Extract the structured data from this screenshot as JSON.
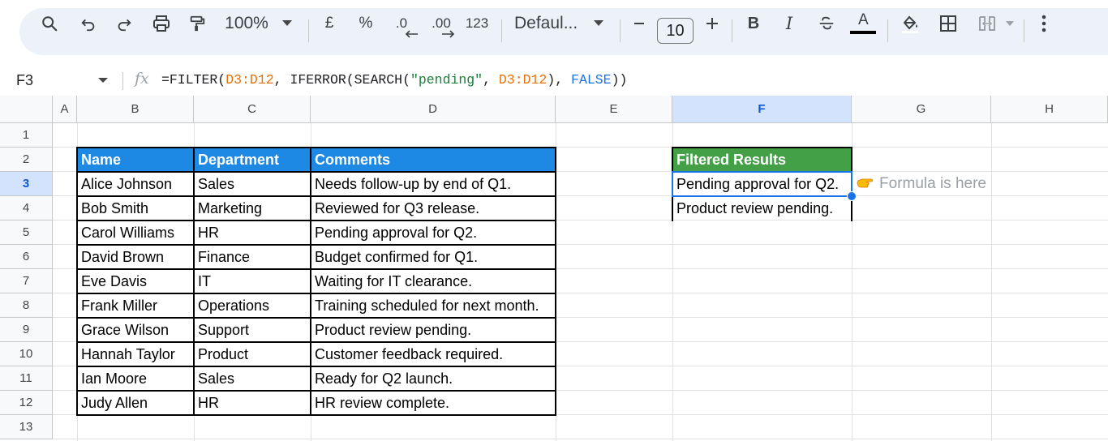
{
  "toolbar": {
    "zoom": "100%",
    "currency": "£",
    "percent": "%",
    "decrease_decimal": ".0",
    "increase_decimal": ".00",
    "number_format": "123",
    "font": "Defaul...",
    "font_size": "10",
    "bold": "B",
    "italic": "I",
    "text_color_letter": "A"
  },
  "formula_bar": {
    "cell_ref": "F3",
    "fx": "fx",
    "formula_parts": [
      "=FILTER(",
      "D3:D12",
      ", IFERROR(SEARCH(",
      "\"pending\"",
      ", ",
      "D3:D12",
      "), ",
      "FALSE",
      "))"
    ]
  },
  "columns": [
    "A",
    "B",
    "C",
    "D",
    "E",
    "F",
    "G",
    "H"
  ],
  "selected_column": "F",
  "rows": [
    "1",
    "2",
    "3",
    "4",
    "5",
    "6",
    "7",
    "8",
    "9",
    "10",
    "11",
    "12",
    "13"
  ],
  "selected_row": "3",
  "table": {
    "headers": [
      "Name",
      "Department",
      "Comments"
    ],
    "rows": [
      [
        "Alice Johnson",
        "Sales",
        "Needs follow-up by end of Q1."
      ],
      [
        "Bob Smith",
        "Marketing",
        "Reviewed for Q3 release."
      ],
      [
        "Carol Williams",
        "HR",
        "Pending approval for Q2."
      ],
      [
        "David Brown",
        "Finance",
        "Budget confirmed for Q1."
      ],
      [
        "Eve Davis",
        "IT",
        "Waiting for IT clearance."
      ],
      [
        "Frank Miller",
        "Operations",
        "Training scheduled for next month."
      ],
      [
        "Grace Wilson",
        "Support",
        "Product review pending."
      ],
      [
        "Hannah Taylor",
        "Product",
        "Customer feedback required."
      ],
      [
        "Ian Moore",
        "Sales",
        "Ready for Q2 launch."
      ],
      [
        "Judy Allen",
        "HR",
        "HR review complete."
      ]
    ],
    "header_color": "#1e88e5"
  },
  "filtered": {
    "header": "Filtered Results",
    "values": [
      "Pending approval for Q2.",
      "Product review pending."
    ],
    "header_color": "#43a047"
  },
  "annotation": {
    "icon": "pointing-hand-icon",
    "text": "Formula is here"
  },
  "colors": {
    "range_ref": "#e8710a",
    "string_lit": "#188038",
    "bool_lit": "#1a73e8",
    "selection": "#1a73e8"
  }
}
